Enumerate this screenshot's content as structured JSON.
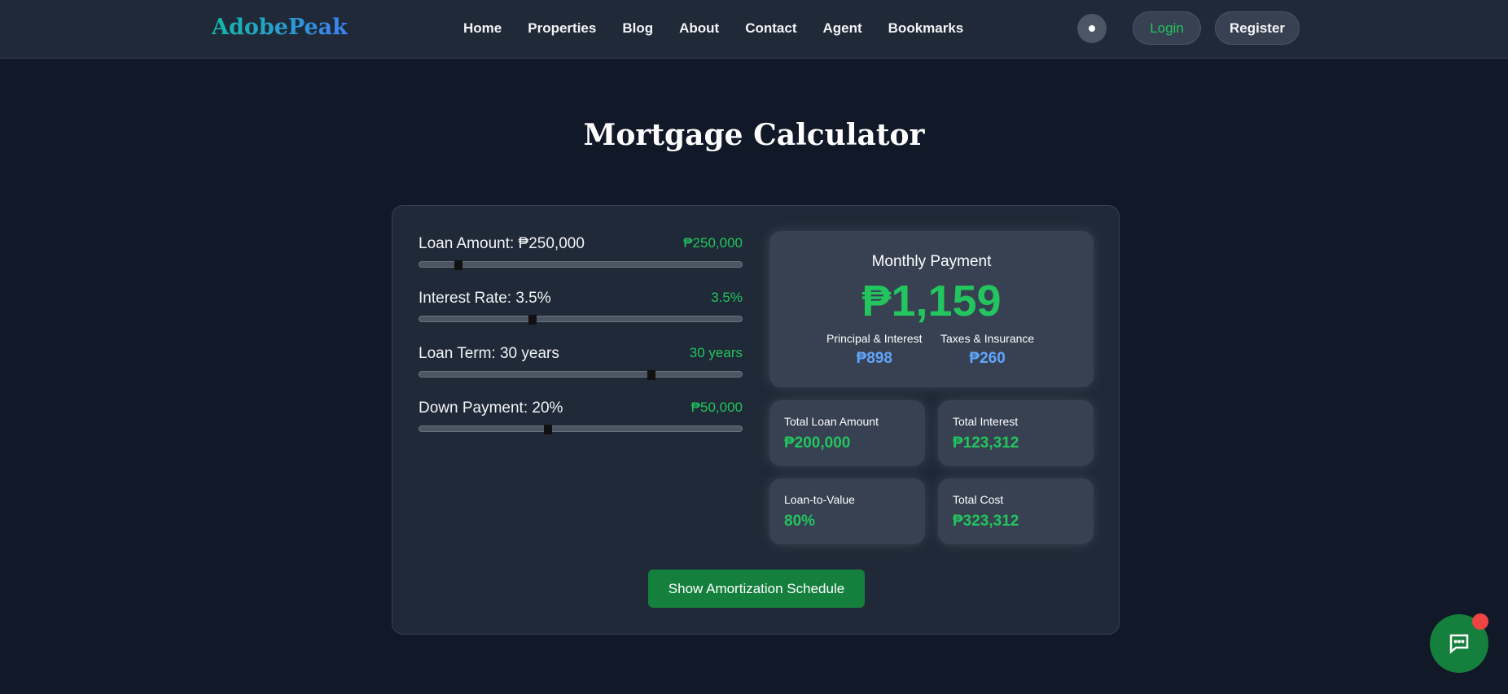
{
  "nav": {
    "logo": "AdobePeak",
    "links": [
      "Home",
      "Properties",
      "Blog",
      "About",
      "Contact",
      "Agent",
      "Bookmarks"
    ],
    "login": "Login",
    "register": "Register"
  },
  "title": "Mortgage Calculator",
  "sliders": [
    {
      "label": "Loan Amount: ₱250,000",
      "value": "₱250,000",
      "thumb_percent": 12
    },
    {
      "label": "Interest Rate: 3.5%",
      "value": "3.5%",
      "thumb_percent": 35
    },
    {
      "label": "Loan Term: 30 years",
      "value": "30 years",
      "thumb_percent": 72
    },
    {
      "label": "Down Payment: 20%",
      "value": "₱50,000",
      "thumb_percent": 40
    }
  ],
  "monthly": {
    "title": "Monthly Payment",
    "amount": "₱1,159",
    "pi_label": "Principal & Interest",
    "pi_value": "₱898",
    "ti_label": "Taxes & Insurance",
    "ti_value": "₱260"
  },
  "stats": [
    {
      "label": "Total Loan Amount",
      "value": "₱200,000"
    },
    {
      "label": "Total Interest",
      "value": "₱123,312"
    },
    {
      "label": "Loan-to-Value",
      "value": "80%"
    },
    {
      "label": "Total Cost",
      "value": "₱323,312"
    }
  ],
  "amort_button": "Show Amortization Schedule"
}
